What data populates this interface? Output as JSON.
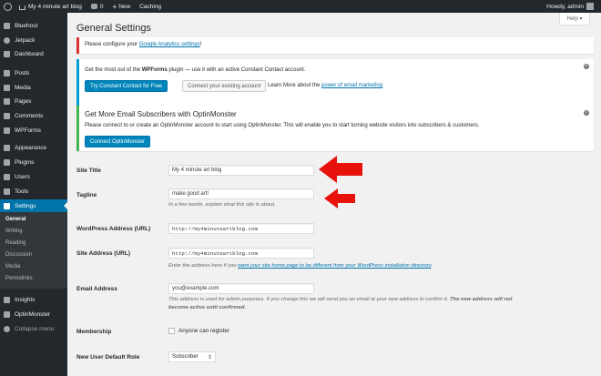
{
  "admin_bar": {
    "site_name": "My 4 minute art blog",
    "comments_count": "0",
    "new_label": "New",
    "caching_label": "Caching",
    "howdy": "Howdy, admin"
  },
  "sidebar": {
    "items": [
      {
        "label": "Bluehost",
        "icon": "bluehost-icon"
      },
      {
        "label": "Jetpack",
        "icon": "jetpack-icon"
      },
      {
        "label": "Dashboard",
        "icon": "dashboard-icon"
      },
      {
        "label": "Posts",
        "icon": "pin-icon"
      },
      {
        "label": "Media",
        "icon": "media-icon"
      },
      {
        "label": "Pages",
        "icon": "pages-icon"
      },
      {
        "label": "Comments",
        "icon": "comments-icon"
      },
      {
        "label": "WPForms",
        "icon": "wpforms-icon"
      },
      {
        "label": "Appearance",
        "icon": "paintbrush-icon"
      },
      {
        "label": "Plugins",
        "icon": "plugin-icon"
      },
      {
        "label": "Users",
        "icon": "users-icon"
      },
      {
        "label": "Tools",
        "icon": "wrench-icon"
      },
      {
        "label": "Settings",
        "icon": "settings-icon"
      }
    ],
    "submenu": [
      "General",
      "Writing",
      "Reading",
      "Discussion",
      "Media",
      "Permalinks"
    ],
    "bottom_items": [
      {
        "label": "Insights",
        "icon": "insights-icon"
      },
      {
        "label": "OptinMonster",
        "icon": "optinmonster-icon"
      }
    ],
    "collapse_label": "Collapse menu"
  },
  "header": {
    "title": "General Settings",
    "help_label": "Help ▾"
  },
  "notices": {
    "analytics": {
      "text": "Please configure your ",
      "link": "Google Analytics settings",
      "suffix": "!"
    },
    "wpforms": {
      "text_prefix": "Get the most out of the ",
      "brand": "WPForms",
      "text_suffix": " plugin — use it with an active Constant Contact account.",
      "primary_button": "Try Constant Contact for Free",
      "secondary_button": "Connect your existing account",
      "learn_prefix": "Learn More about the ",
      "learn_link": "power of email marketing"
    },
    "optinmonster": {
      "title": "Get More Email Subscribers with OptinMonster",
      "text": "Please connect to or create an OptinMonster account to start using OptinMonster. This will enable you to start turning website visitors into subscribers & customers.",
      "button": "Connect OptinMonster"
    }
  },
  "form": {
    "site_title": {
      "label": "Site Title",
      "value": "My 4 minute art blog"
    },
    "tagline": {
      "label": "Tagline",
      "value": "make good art!",
      "description": "In a few words, explain what this site is about."
    },
    "wp_address": {
      "label": "WordPress Address (URL)",
      "value": "http://my4minuteartblog.com"
    },
    "site_address": {
      "label": "Site Address (URL)",
      "value": "http://my4minuteartblog.com",
      "desc_prefix": "Enter the address here if you ",
      "desc_link": "want your site home page to be different from your WordPress installation directory",
      "desc_suffix": "."
    },
    "email": {
      "label": "Email Address",
      "value": "you@example.com",
      "desc_line1": "This address is used for admin purposes. If you change this we will send you an email at your new address to confirm it. ",
      "desc_bold1": "The new address will not",
      "desc_bold2": "become active until confirmed."
    },
    "membership": {
      "label": "Membership",
      "checkbox_label": "Anyone can register"
    },
    "default_role": {
      "label": "New User Default Role",
      "value": "Subscriber"
    }
  },
  "colors": {
    "sidebar_bg": "#23282d",
    "active_blue": "#0073aa",
    "arrow_red": "#e8120c"
  }
}
